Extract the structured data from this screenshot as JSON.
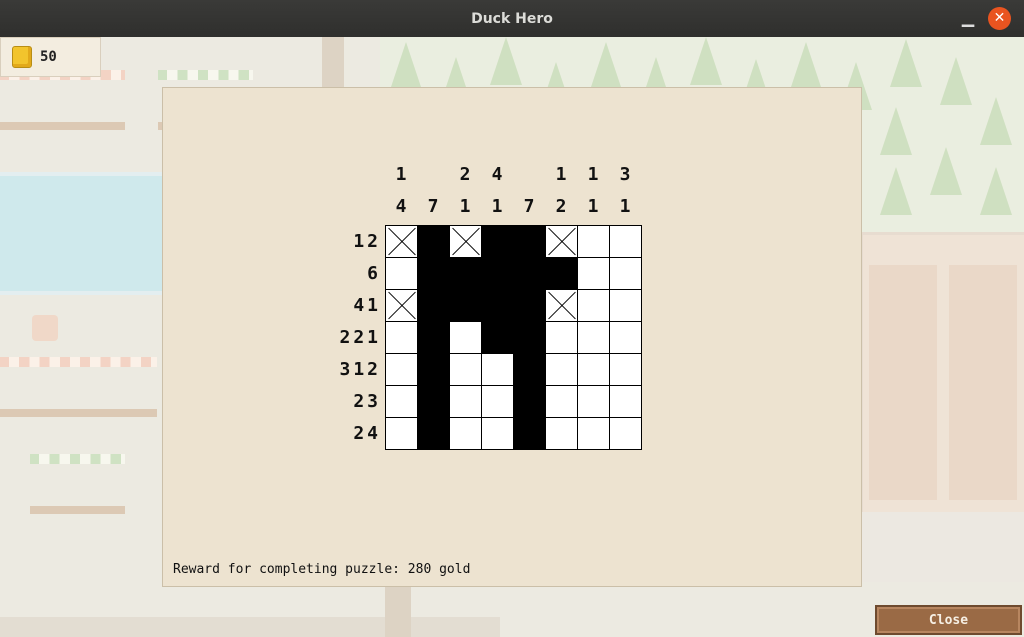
{
  "window": {
    "title": "Duck Hero"
  },
  "hud": {
    "gold": "50",
    "coin_icon": "gold-coin-stack-icon"
  },
  "puzzle": {
    "col_clues": [
      [
        "1",
        "4"
      ],
      [
        "7"
      ],
      [
        "2",
        "1"
      ],
      [
        "4",
        "1"
      ],
      [
        "7"
      ],
      [
        "1",
        "2"
      ],
      [
        "1",
        "1"
      ],
      [
        "3",
        "1"
      ]
    ],
    "row_clues": [
      "1 2",
      "6",
      "4 1",
      "2 2 1",
      "3 1 2",
      "2 3",
      "2 4"
    ],
    "cells": [
      [
        "x",
        "f",
        "x",
        "f",
        "f",
        "x",
        "e",
        "e"
      ],
      [
        "e",
        "f",
        "f",
        "f",
        "f",
        "f",
        "e",
        "e"
      ],
      [
        "x",
        "f",
        "f",
        "f",
        "f",
        "x",
        "e",
        "e"
      ],
      [
        "e",
        "f",
        "e",
        "f",
        "f",
        "e",
        "e",
        "e"
      ],
      [
        "e",
        "f",
        "e",
        "e",
        "f",
        "e",
        "e",
        "e"
      ],
      [
        "e",
        "f",
        "e",
        "e",
        "f",
        "e",
        "e",
        "e"
      ],
      [
        "e",
        "f",
        "e",
        "e",
        "f",
        "e",
        "e",
        "e"
      ]
    ],
    "reward_text": "Reward for completing puzzle: 280 gold"
  },
  "buttons": {
    "close_label": "Close"
  }
}
